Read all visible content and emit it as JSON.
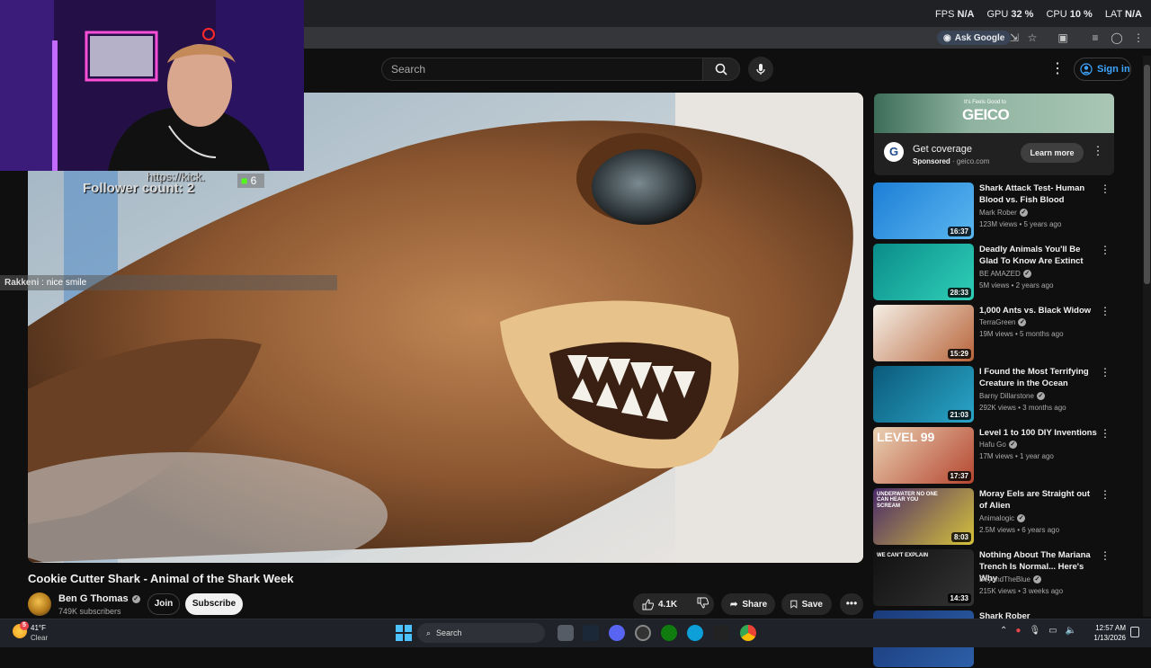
{
  "perf": {
    "fps_label": "FPS",
    "fps": "N/A",
    "gpu_label": "GPU",
    "gpu": "32 %",
    "cpu_label": "CPU",
    "cpu": "10 %",
    "lat_label": "LAT",
    "lat": "N/A"
  },
  "browser": {
    "ask_google": "Ask Google"
  },
  "header": {
    "search_placeholder": "Search",
    "sign_in": "Sign in"
  },
  "overlay": {
    "kick_url": "https://kick.",
    "kick_count": "6",
    "follower": "Follower count: 2",
    "chat_user": "Rakkeni",
    "chat_msg": " : nice smile"
  },
  "video": {
    "title": "Cookie Cutter Shark - Animal of the Shark Week",
    "channel": "Ben G Thomas",
    "subscribers": "749K subscribers",
    "join": "Join",
    "subscribe": "Subscribe",
    "likes": "4.1K",
    "share": "Share",
    "save": "Save"
  },
  "ad": {
    "banner_brand": "GEICO",
    "banner_tag": "It's Feels Good to",
    "title": "Get coverage",
    "sponsored": "Sponsored",
    "domain": "geico.com",
    "cta": "Learn more"
  },
  "related": [
    {
      "title": "Shark Attack Test- Human Blood vs. Fish Blood",
      "channel": "Mark Rober",
      "meta": "123M views • 5 years ago",
      "duration": "16:37",
      "color1": "#1d7fd6",
      "color2": "#5bb7f0"
    },
    {
      "title": "Deadly Animals You'll Be Glad To Know Are Extinct",
      "channel": "BE AMAZED",
      "meta": "5M views • 2 years ago",
      "duration": "28:33",
      "color1": "#0a8c8a",
      "color2": "#2fd0b8"
    },
    {
      "title": "1,000 Ants vs. Black Widow",
      "channel": "TerraGreen",
      "meta": "19M views • 5 months ago",
      "duration": "15:29",
      "color1": "#f4efe6",
      "color2": "#b8643a"
    },
    {
      "title": "I Found the Most Terrifying Creature in the Ocean",
      "channel": "Barny Dillarstone",
      "meta": "292K views • 3 months ago",
      "duration": "21:03",
      "color1": "#0b5a7a",
      "color2": "#2aa6c8"
    },
    {
      "title": "Level 1 to 100 DIY Inventions",
      "channel": "Hafu Go",
      "meta": "17M views • 1 year ago",
      "duration": "17:37",
      "color1": "#e9d2b4",
      "color2": "#b5452f",
      "overlay": "LEVEL 99"
    },
    {
      "title": "Moray Eels are Straight out of Alien",
      "channel": "Animalogic",
      "meta": "2.5M views • 6 years ago",
      "duration": "8:03",
      "color1": "#4a2a6a",
      "color2": "#d6c23b",
      "overlay": "UNDERWATER NO ONE CAN HEAR YOU SCREAM"
    },
    {
      "title": "Nothing About The Mariana Trench Is Normal... Here's Why",
      "channel": "BeyondTheBlue",
      "meta": "215K views • 3 weeks ago",
      "duration": "14:33",
      "color1": "#111",
      "color2": "#333",
      "overlay": "WE CAN'T EXPLAIN"
    },
    {
      "title": "Shark Rober",
      "channel": "",
      "meta": "",
      "duration": "",
      "color1": "#1a3a7a",
      "color2": "#2d5fa8"
    }
  ],
  "taskbar": {
    "temp": "41°F",
    "condition": "Clear",
    "weather_badge": "5",
    "search": "Search",
    "time": "12:57 AM",
    "date": "1/13/2026"
  }
}
